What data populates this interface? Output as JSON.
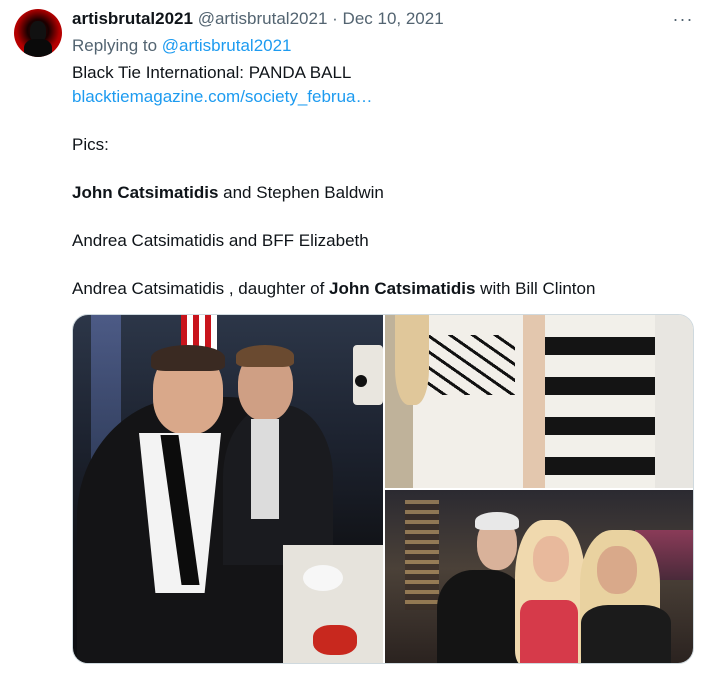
{
  "author": {
    "display_name": "artisbrutal2021",
    "handle": "@artisbrutal2021",
    "separator": "·",
    "date": "Dec 10, 2021"
  },
  "more_icon": "···",
  "reply": {
    "prefix": "Replying to",
    "handle": "@artisbrutal2021"
  },
  "body": {
    "line1": "Black Tie International: PANDA BALL",
    "link": "blacktiemagazine.com/society_februa…",
    "pics_label": "Pics:",
    "caption1": {
      "bold": "John Catsimatidis",
      "rest": " and Stephen Baldwin"
    },
    "caption2": "Andrea Catsimatidis and BFF Elizabeth",
    "caption3": {
      "pre": "Andrea Catsimatidis , daughter of ",
      "bold": "John Catsimatidis",
      "post": " with Bill Clinton"
    }
  },
  "icons": {
    "more": "ellipsis-icon"
  },
  "colors": {
    "link": "#1d9bf0",
    "muted": "#536471",
    "text": "#0f1419"
  }
}
